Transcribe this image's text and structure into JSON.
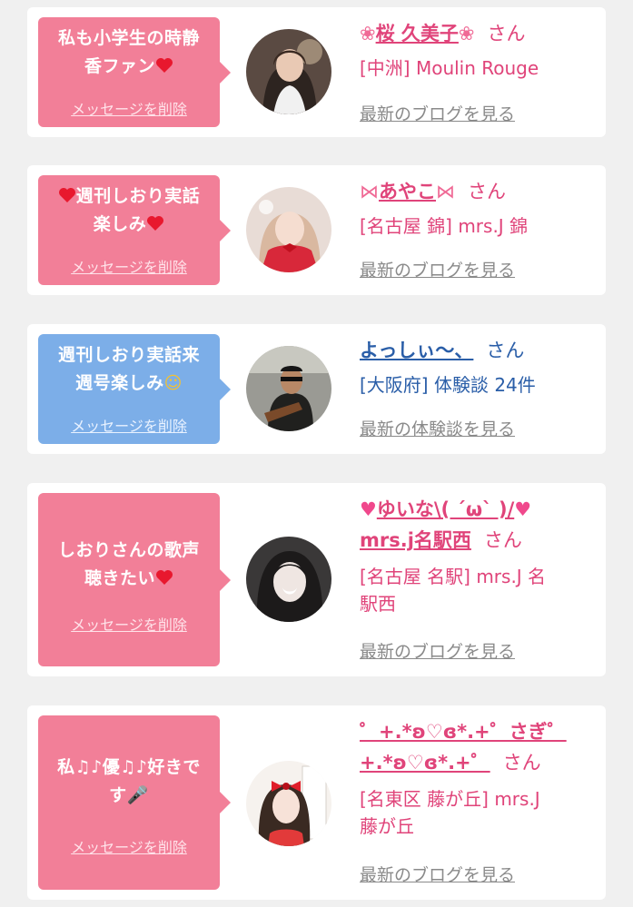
{
  "delete_label": "メッセージを削除",
  "honorific": "さん",
  "colors": {
    "pink_bubble": "#f27f98",
    "blue_bubble": "#7caee8",
    "pink_text": "#e0447a",
    "blue_text": "#2a5ea8",
    "gray_link": "#8a8a8a",
    "background": "#f0f0f0"
  },
  "cards": [
    {
      "message": {
        "line1": "私も小学生の時静",
        "line2": "香ファン",
        "line2_icon": "heart-icon"
      },
      "name": {
        "prefix_icon": "cherry-blossom-icon",
        "text": "桜 久美子",
        "suffix_icon": "cherry-blossom-icon",
        "prefix_glyph": "❀",
        "suffix_glyph": "❀"
      },
      "shop": "[中洲] Moulin Rouge",
      "link": "最新のブログを見る"
    },
    {
      "message": {
        "line1_icon": "heart-icon",
        "line1": "週刊しおり実話",
        "line2": "楽しみ",
        "line2_icon": "heart-icon"
      },
      "name": {
        "prefix_icon": "ribbon-icon",
        "text": "あやこ",
        "suffix_icon": "ribbon-icon",
        "prefix_glyph": "⋈",
        "suffix_glyph": "⋈"
      },
      "shop": "[名古屋 錦] mrs.J 錦",
      "link": "最新のブログを見る"
    },
    {
      "message": {
        "line1": "週刊しおり実話来",
        "line2": "週号楽しみ",
        "line2_icon": "grinning-face-icon",
        "line2_glyph": "☺"
      },
      "name": {
        "text": "よっしぃ〜、"
      },
      "shop": "[大阪府] 体験談 24件",
      "link": "最新の体験談を見る"
    },
    {
      "message": {
        "line1": "しおりさんの歌声",
        "line2": "聴きたい",
        "line2_icon": "heart-icon"
      },
      "name": {
        "prefix_icon": "sparkling-heart-icon",
        "line1": "ゆいな\\( ´ω` )/",
        "suffix_icon": "sparkling-heart-icon",
        "line2": "mrs.j名駅西",
        "prefix_glyph": "♥",
        "suffix_glyph": "♥"
      },
      "shop_line1": "[名古屋 名駅] mrs.J 名",
      "shop_line2": "駅西",
      "link": "最新のブログを見る"
    },
    {
      "message": {
        "line1": "私♫♪優♫♪好きで",
        "line2": "す",
        "line2_icon": "microphone-icon",
        "line2_glyph": "🎤"
      },
      "name": {
        "line1": "゜+.*ʚ♡ɞ*.+゜さぎ゜",
        "line2": "+.*ʚ♡ɞ*.+゜"
      },
      "shop_line1": "[名東区 藤が丘] mrs.J",
      "shop_line2": "藤が丘",
      "link": "最新のブログを見る"
    }
  ]
}
